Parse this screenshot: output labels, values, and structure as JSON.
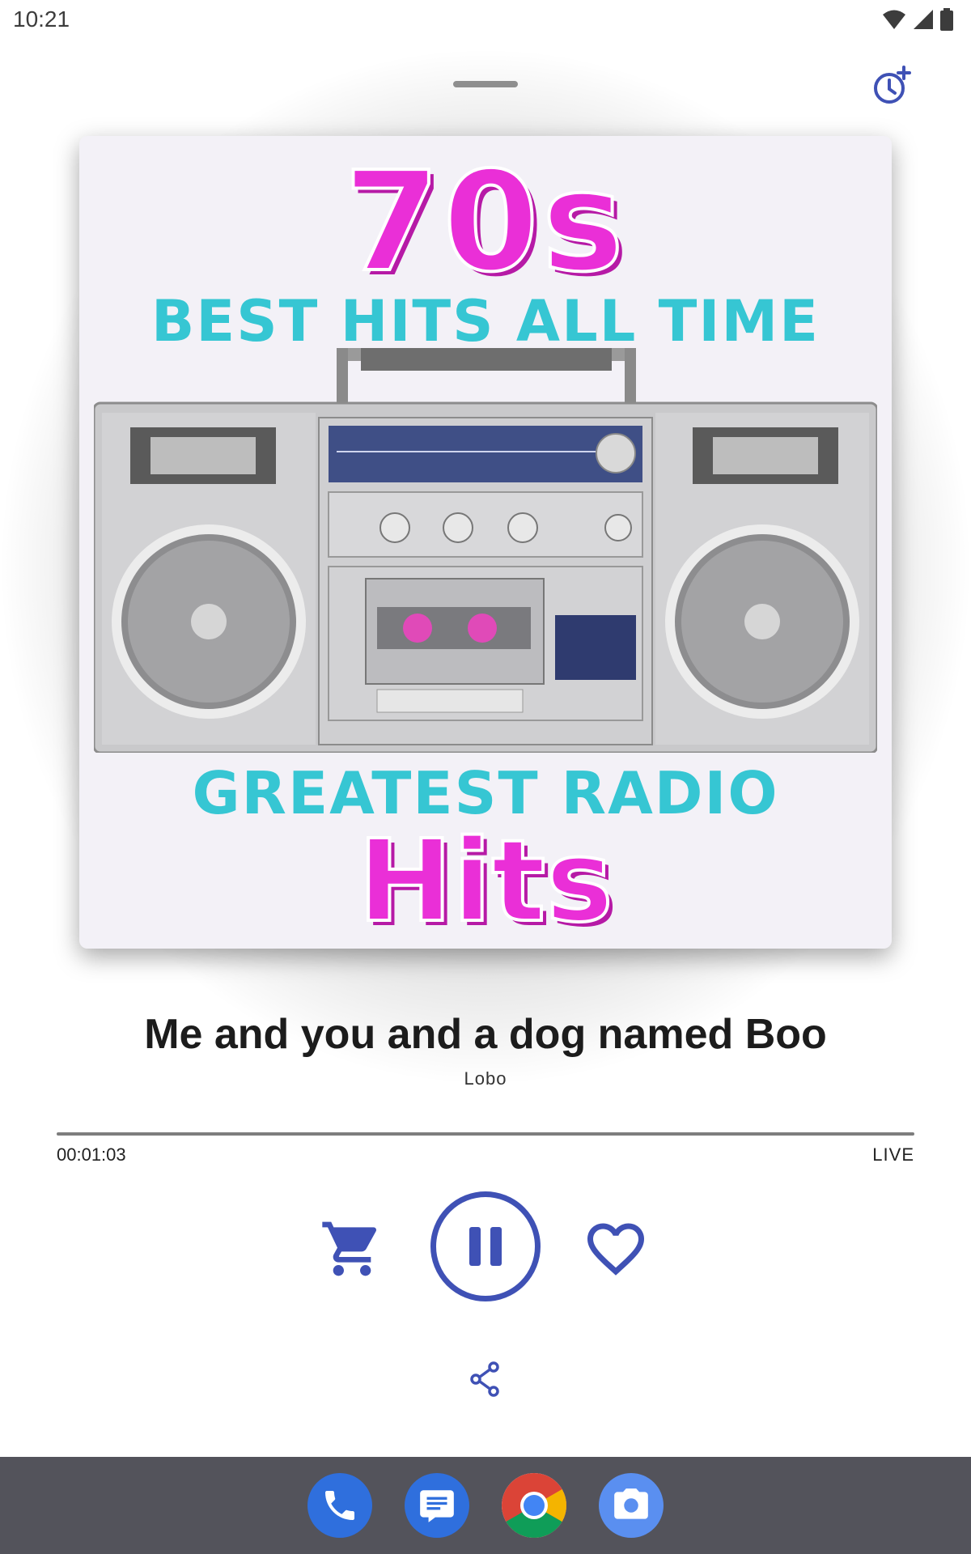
{
  "status_bar": {
    "time": "10:21"
  },
  "artwork": {
    "line1": "70s",
    "line2": "BEST HITS ALL TIME",
    "line3": "GREATEST RADIO",
    "line4": "Hits"
  },
  "now_playing": {
    "title": "Me and you and a dog named Boo",
    "artist": "Lobo",
    "elapsed": "00:01:03",
    "live_label": "LIVE",
    "progress": 1.0
  },
  "colors": {
    "accent": "#3f51b5",
    "magenta": "#ea2fd7",
    "cyan": "#36c6d3"
  },
  "icons": {
    "alarm": "alarm-add-icon",
    "cart": "cart-icon",
    "pause": "pause-icon",
    "heart": "heart-outline-icon",
    "share": "share-icon",
    "dock": [
      "phone-icon",
      "messages-icon",
      "chrome-icon",
      "camera-icon"
    ]
  }
}
